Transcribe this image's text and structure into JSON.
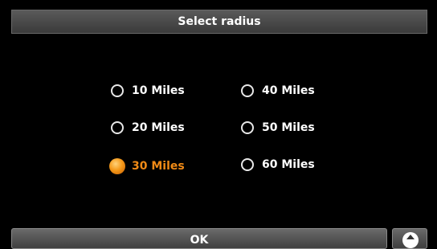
{
  "header": {
    "title": "Select radius"
  },
  "options": [
    {
      "label": "10 Miles",
      "selected": false
    },
    {
      "label": "20 Miles",
      "selected": false
    },
    {
      "label": "30 Miles",
      "selected": true
    },
    {
      "label": "40 Miles",
      "selected": false
    },
    {
      "label": "50 Miles",
      "selected": false
    },
    {
      "label": "60 Miles",
      "selected": false
    }
  ],
  "footer": {
    "ok_label": "OK",
    "nav_icon": "up-arrow-icon"
  },
  "colors": {
    "selected_text": "#f08a16",
    "background": "#000000"
  }
}
